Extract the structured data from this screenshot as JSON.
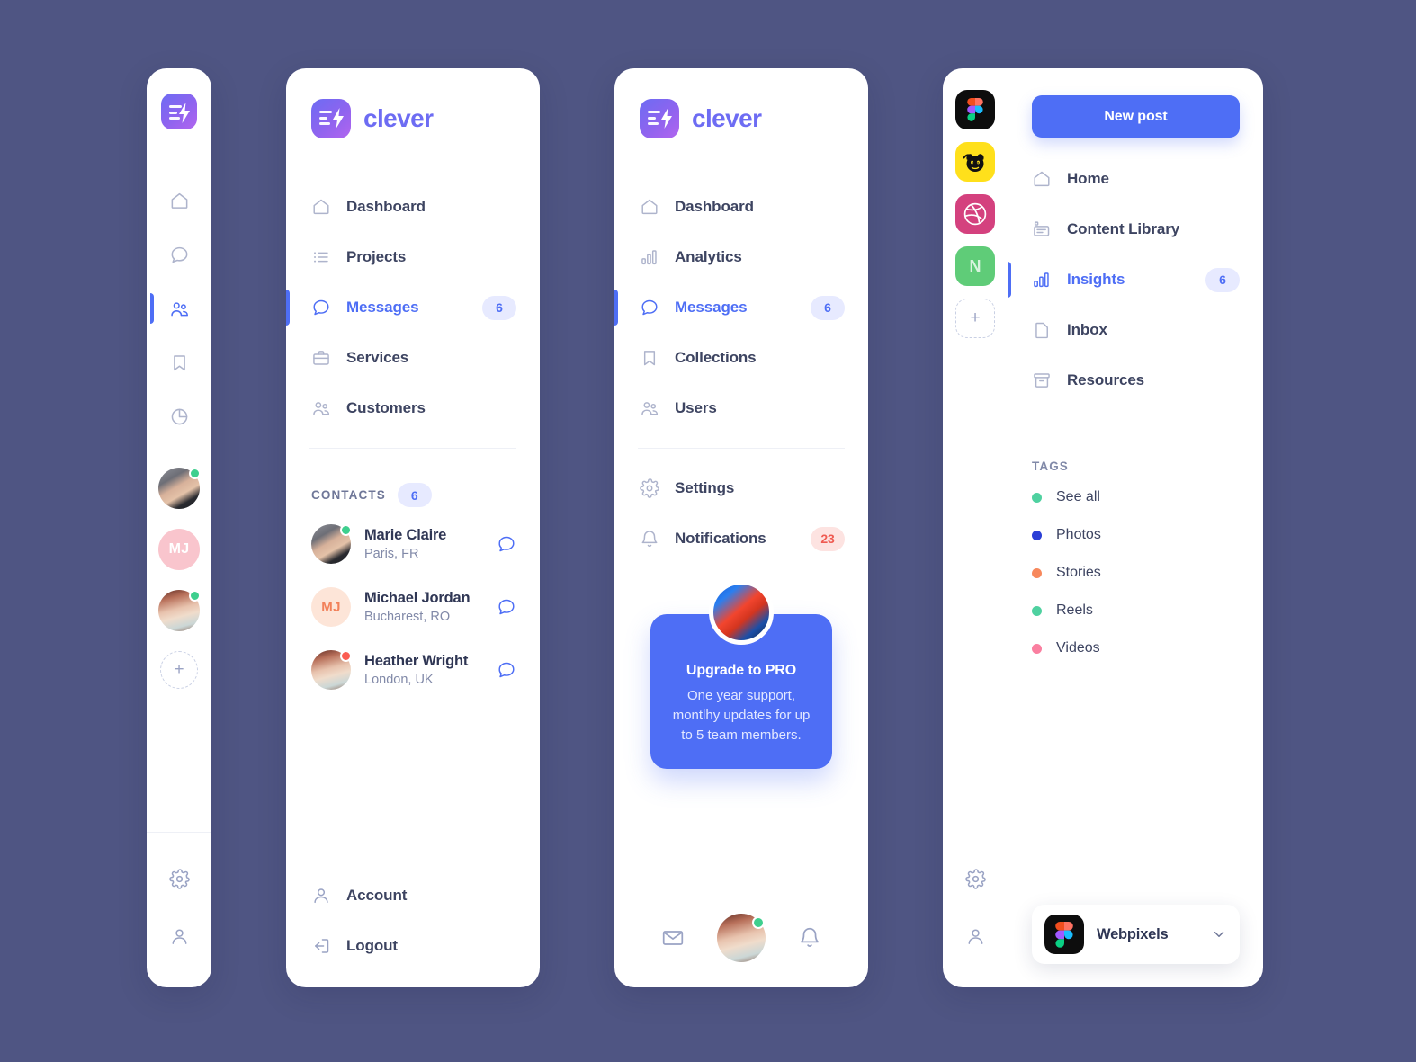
{
  "theme": {
    "background": "#4f5583",
    "panel": "#ffffff",
    "accent": "#4e6ef5",
    "brand_purple": "#6d6cf3",
    "muted_icon": "#aeb4cc",
    "text_dark": "#2f3654",
    "badge_blue_bg": "#e7eaff",
    "badge_red_bg": "#fde3e1",
    "badge_red_text": "#ef5b52",
    "status_online": "#3ecf8e",
    "status_busy": "#fb5d52"
  },
  "icon_rail": {
    "logo_name": "clever-logo-mark",
    "items": [
      {
        "icon": "home-icon",
        "name": "home",
        "active": false
      },
      {
        "icon": "chat-bubble-icon",
        "name": "messages",
        "active": false
      },
      {
        "icon": "users-icon",
        "name": "customers",
        "active": true
      },
      {
        "icon": "bookmark-icon",
        "name": "collections",
        "active": false
      },
      {
        "icon": "pie-chart-icon",
        "name": "analytics",
        "active": false
      }
    ],
    "avatars": [
      {
        "type": "photo",
        "name": "marie-claire",
        "status": "online"
      },
      {
        "type": "initials",
        "initials": "MJ",
        "name": "michael-jordan",
        "status": "online",
        "bg": "#f9c5cd",
        "color": "#ffffff"
      },
      {
        "type": "photo",
        "name": "heather-wright",
        "status": "online"
      }
    ],
    "add_label": "+",
    "bottom_items": [
      {
        "icon": "gear-icon",
        "name": "settings"
      },
      {
        "icon": "user-icon",
        "name": "account"
      }
    ]
  },
  "clever_panel_a": {
    "brand": "clever",
    "nav": [
      {
        "label": "Dashboard",
        "icon": "home-icon",
        "active": false,
        "badge": null
      },
      {
        "label": "Projects",
        "icon": "list-icon",
        "active": false,
        "badge": null
      },
      {
        "label": "Messages",
        "icon": "chat-bubble-icon",
        "active": true,
        "badge": "6"
      },
      {
        "label": "Services",
        "icon": "briefcase-icon",
        "active": false,
        "badge": null
      },
      {
        "label": "Customers",
        "icon": "users-icon",
        "active": false,
        "badge": null
      }
    ],
    "contacts_title": "CONTACTS",
    "contacts_count": "6",
    "contacts": [
      {
        "name": "Marie Claire",
        "location": "Paris, FR",
        "status": "online",
        "avatar_type": "photo"
      },
      {
        "name": "Michael Jordan",
        "location": "Bucharest, RO",
        "status": "none",
        "avatar_type": "initials",
        "initials": "MJ",
        "bg": "#fde5d8",
        "color": "#f2815a"
      },
      {
        "name": "Heather Wright",
        "location": "London, UK",
        "status": "busy",
        "avatar_type": "photo"
      }
    ],
    "footer": [
      {
        "label": "Account",
        "icon": "user-icon"
      },
      {
        "label": "Logout",
        "icon": "logout-icon"
      }
    ]
  },
  "clever_panel_b": {
    "brand": "clever",
    "nav": [
      {
        "label": "Dashboard",
        "icon": "home-icon",
        "active": false,
        "badge": null
      },
      {
        "label": "Analytics",
        "icon": "bar-chart-icon",
        "active": false,
        "badge": null
      },
      {
        "label": "Messages",
        "icon": "chat-bubble-icon",
        "active": true,
        "badge": "6"
      },
      {
        "label": "Collections",
        "icon": "bookmark-icon",
        "active": false,
        "badge": null
      },
      {
        "label": "Users",
        "icon": "users-icon",
        "active": false,
        "badge": null
      }
    ],
    "nav_secondary": [
      {
        "label": "Settings",
        "icon": "gear-icon",
        "active": false,
        "badge": null
      },
      {
        "label": "Notifications",
        "icon": "bell-icon",
        "active": false,
        "badge": "23",
        "badge_style": "red"
      }
    ],
    "upgrade": {
      "title": "Upgrade to PRO",
      "text": "One year support, montlhy updates for up to 5 team members."
    },
    "bottom_bar": [
      {
        "icon": "mail-icon",
        "name": "mail"
      },
      {
        "icon": "avatar",
        "name": "profile",
        "status": "online"
      },
      {
        "icon": "bell-icon",
        "name": "notifications"
      }
    ]
  },
  "social_panel": {
    "apps": [
      {
        "name": "figma-app-icon",
        "bg": "#0d0d0d",
        "label": ""
      },
      {
        "name": "mailchimp-app-icon",
        "bg": "#ffe01b",
        "label": ""
      },
      {
        "name": "dribbble-app-icon",
        "bg": "#d4417e",
        "label": ""
      },
      {
        "name": "notion-app-icon",
        "bg": "#5fcc78",
        "label": "N"
      }
    ],
    "add_app_label": "+",
    "new_post_label": "New post",
    "nav": [
      {
        "label": "Home",
        "icon": "home-icon",
        "active": false,
        "badge": null
      },
      {
        "label": "Content Library",
        "icon": "content-library-icon",
        "active": false,
        "badge": null
      },
      {
        "label": "Insights",
        "icon": "bar-chart-icon",
        "active": true,
        "badge": "6"
      },
      {
        "label": "Inbox",
        "icon": "inbox-page-icon",
        "active": false,
        "badge": null
      },
      {
        "label": "Resources",
        "icon": "archive-icon",
        "active": false,
        "badge": null
      }
    ],
    "tags_title": "TAGS",
    "tags": [
      {
        "label": "See all",
        "color": "#4fd1a0"
      },
      {
        "label": "Photos",
        "color": "#2b3fd6"
      },
      {
        "label": "Stories",
        "color": "#f7885c"
      },
      {
        "label": "Reels",
        "color": "#4fd1a0"
      },
      {
        "label": "Videos",
        "color": "#fa7fa0"
      }
    ],
    "workspace": {
      "name": "Webpixels",
      "icon": "figma-icon",
      "chevron": "chevron-down-icon"
    },
    "bottom_items": [
      {
        "icon": "gear-icon",
        "name": "settings"
      },
      {
        "icon": "user-icon",
        "name": "account"
      }
    ]
  }
}
